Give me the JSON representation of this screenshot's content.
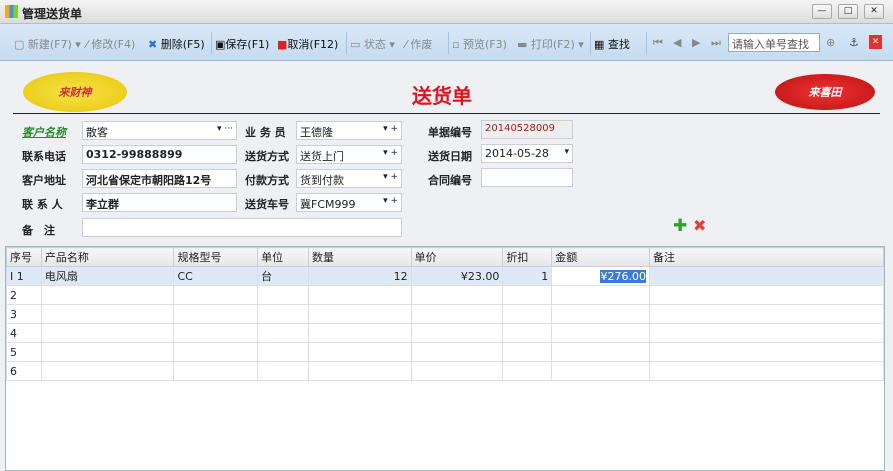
{
  "window": {
    "title": "管理送货单",
    "min": "—",
    "max": "□",
    "close": "✕"
  },
  "toolbar": {
    "new": "新建(F7)",
    "edit": "修改(F4)",
    "delete": "删除(F5)",
    "save": "保存(F1)",
    "cancel": "取消(F12)",
    "status": "状态",
    "void": "作废",
    "preview": "预览(F3)",
    "print": "打印(F2)",
    "find": "查找",
    "search_placeholder": "请输入单号查找"
  },
  "header": {
    "title": "送货单",
    "stamp_left": "来财神",
    "stamp_right": "来喜田"
  },
  "form": {
    "customer_label": "客户名称",
    "customer": "散客",
    "phone_label": "联系电话",
    "phone": "0312-99888899",
    "address_label": "客户地址",
    "address": "河北省保定市朝阳路12号",
    "contact_label": "联 系 人",
    "contact": "李立群",
    "remark_label": "备　注",
    "remark": "",
    "salesman_label": "业 务 员",
    "salesman": "王德隆",
    "delivery_label": "送货方式",
    "delivery": "送货上门",
    "payment_label": "付款方式",
    "payment": "货到付款",
    "vehicle_label": "送货车号",
    "vehicle": "冀FCM999",
    "docno_label": "单据编号",
    "docno": "20140528009",
    "date_label": "送货日期",
    "date": "2014-05-28",
    "contract_label": "合同编号",
    "contract": ""
  },
  "grid": {
    "columns": [
      "序号",
      "产品名称",
      "规格型号",
      "单位",
      "数量",
      "单价",
      "折扣",
      "金额",
      "备注"
    ],
    "rows": [
      [
        "I 1",
        "电风扇",
        "CC",
        "台",
        "12",
        "¥23.00",
        "1",
        "¥276.00",
        ""
      ],
      [
        "2",
        "",
        "",
        "",
        "",
        "",
        "",
        "",
        ""
      ],
      [
        "3",
        "",
        "",
        "",
        "",
        "",
        "",
        "",
        ""
      ],
      [
        "4",
        "",
        "",
        "",
        "",
        "",
        "",
        "",
        ""
      ],
      [
        "5",
        "",
        "",
        "",
        "",
        "",
        "",
        "",
        ""
      ],
      [
        "6",
        "",
        "",
        "",
        "",
        "",
        "",
        "",
        ""
      ]
    ]
  }
}
